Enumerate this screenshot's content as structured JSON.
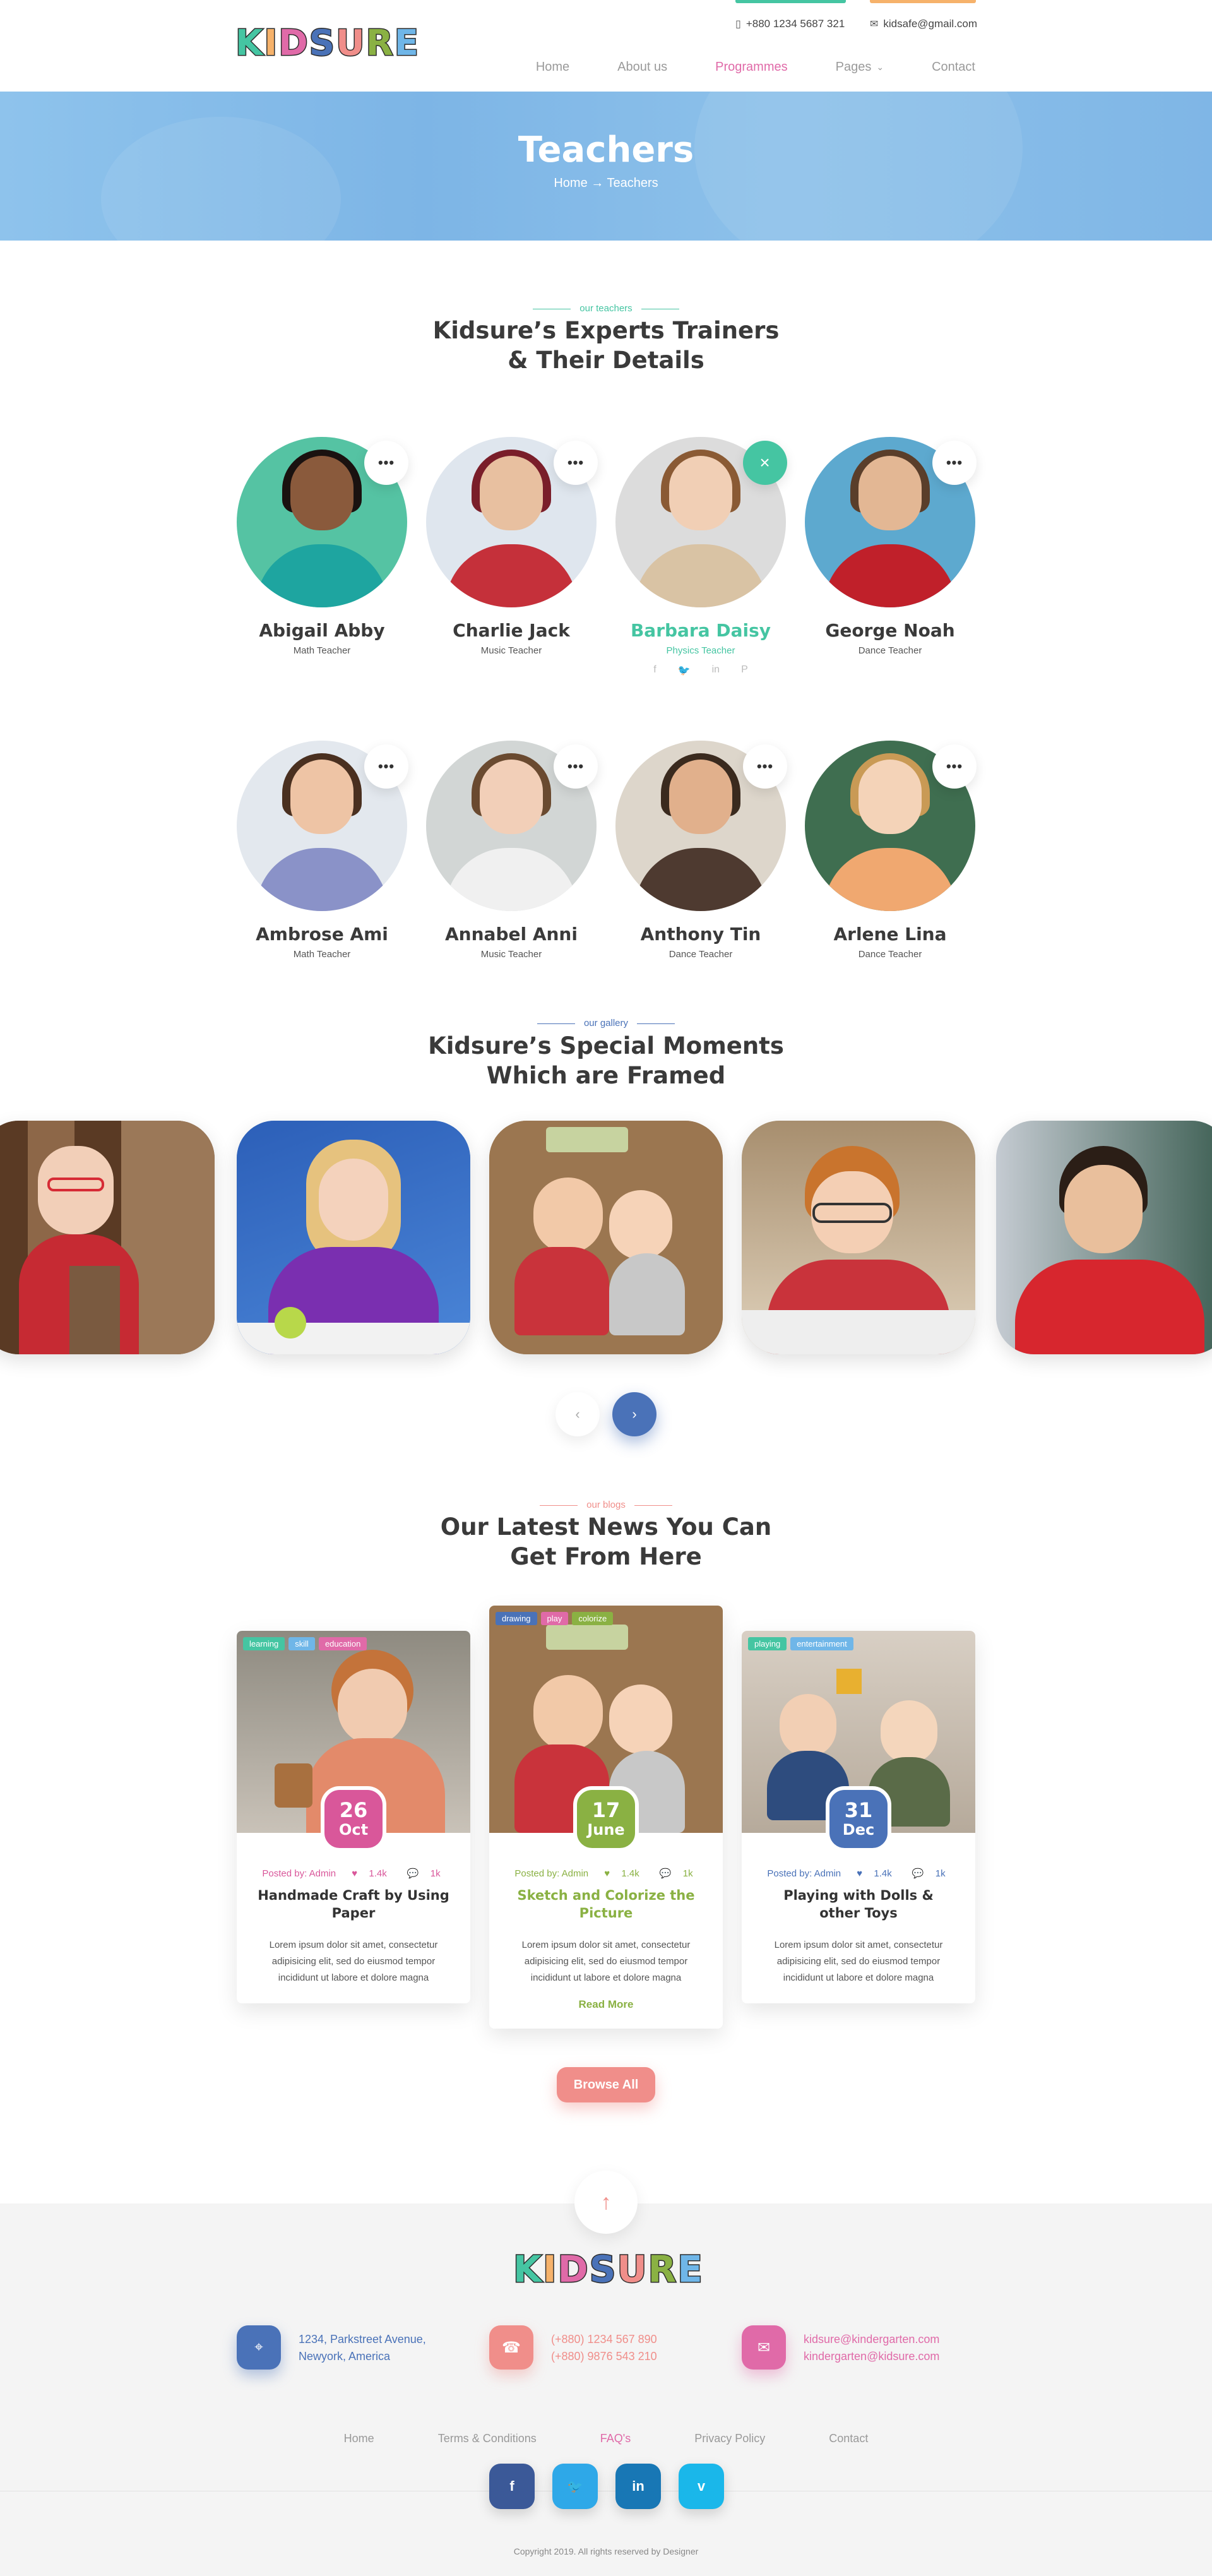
{
  "header": {
    "logo": "KIDSURE",
    "phone": "+880 1234 5687 321",
    "email": "kidsafe@gmail.com",
    "accent_left": "#45c5a2",
    "accent_right": "#f6b26b",
    "nav": [
      {
        "label": "Home",
        "active": false
      },
      {
        "label": "About us",
        "active": false
      },
      {
        "label": "Programmes",
        "active": true
      },
      {
        "label": "Pages",
        "active": false,
        "dropdown": true
      },
      {
        "label": "Contact",
        "active": false
      }
    ]
  },
  "banner": {
    "title": "Teachers",
    "breadcrumb_home": "Home",
    "breadcrumb_sep": "→",
    "breadcrumb_current": "Teachers"
  },
  "teachers_section": {
    "eyebrow": "our teachers",
    "title_line1": "Kidsure’s Experts Trainers",
    "title_line2": "& Their Details",
    "teachers": [
      {
        "name": "Abigail Abby",
        "role": "Math Teacher",
        "bg": "#55c3a3"
      },
      {
        "name": "Charlie Jack",
        "role": "Music Teacher",
        "bg": "#dfe6ee"
      },
      {
        "name": "Barbara Daisy",
        "role": "Physics Teacher",
        "bg": "#dcdcdc",
        "active": true
      },
      {
        "name": "George Noah",
        "role": "Dance Teacher",
        "bg": "#5da9cf"
      },
      {
        "name": "Ambrose Ami",
        "role": "Math Teacher",
        "bg": "#e3e8ee"
      },
      {
        "name": "Annabel Anni",
        "role": "Music Teacher",
        "bg": "#d2d6d5"
      },
      {
        "name": "Anthony Tin",
        "role": "Dance Teacher",
        "bg": "#ddd6cb"
      },
      {
        "name": "Arlene Lina",
        "role": "Dance Teacher",
        "bg": "#3f6e50"
      }
    ],
    "social_icons": [
      "facebook-icon",
      "twitter-icon",
      "linkedin-icon",
      "pinterest-icon"
    ],
    "active_social": "twitter-icon"
  },
  "gallery_section": {
    "eyebrow": "our gallery",
    "title_line1": "Kidsure’s Special Moments",
    "title_line2": "Which are Framed",
    "prev_icon": "‹",
    "next_icon": "›"
  },
  "blog_section": {
    "eyebrow": "our blogs",
    "title_line1": "Our Latest News You Can",
    "title_line2": "Get From Here",
    "posts": [
      {
        "tags": [
          "learning",
          "skill",
          "education"
        ],
        "day": "26",
        "month": "Oct",
        "posted_by": "Posted by: Admin",
        "likes": "1.4k",
        "comments": "1k",
        "title_line1": "Handmade Craft by Using",
        "title_line2": "Paper",
        "text_line1": "Lorem ipsum dolor sit amet, consectetur",
        "text_line2": "adipisicing elit, sed do eiusmod tempor",
        "text_line3": "incididunt ut labore et dolore magna",
        "color": "#d9579a"
      },
      {
        "tags": [
          "drawing",
          "play",
          "colorize"
        ],
        "day": "17",
        "month": "June",
        "posted_by": "Posted by: Admin",
        "likes": "1.4k",
        "comments": "1k",
        "title_line1": "Sketch and Colorize the",
        "title_line2": "Picture",
        "text_line1": "Lorem ipsum dolor sit amet, consectetur",
        "text_line2": "adipisicing elit, sed do eiusmod tempor",
        "text_line3": "incididunt ut labore et dolore magna",
        "read_more": "Read More",
        "color": "#8ab143"
      },
      {
        "tags": [
          "playing",
          "entertainment"
        ],
        "day": "31",
        "month": "Dec",
        "posted_by": "Posted by: Admin",
        "likes": "1.4k",
        "comments": "1k",
        "title_line1": "Playing with Dolls &",
        "title_line2": "other Toys",
        "text_line1": "Lorem ipsum dolor sit amet, consectetur",
        "text_line2": "adipisicing elit, sed do eiusmod tempor",
        "text_line3": "incididunt ut labore et dolore magna",
        "color": "#4a72b8"
      }
    ],
    "browse_label": "Browse All"
  },
  "footer": {
    "logo": "KIDSURE",
    "address_line1": "1234, Parkstreet Avenue,",
    "address_line2": "Newyork, America",
    "phone_line1": "(+880) 1234 567 890",
    "phone_line2": "(+880) 9876 543 210",
    "email_line1": "kidsure@kindergarten.com",
    "email_line2": "kindergarten@kidsure.com",
    "nav": [
      {
        "label": "Home",
        "active": false
      },
      {
        "label": "Terms & Conditions",
        "active": false
      },
      {
        "label": "FAQ's",
        "active": true
      },
      {
        "label": "Privacy Policy",
        "active": false
      },
      {
        "label": "Contact",
        "active": false
      }
    ],
    "socials": [
      {
        "label": "f",
        "color": "#3b5998"
      },
      {
        "label": "🐦",
        "color": "#2ea8e8"
      },
      {
        "label": "in",
        "color": "#1877b5"
      },
      {
        "label": "v",
        "color": "#1ab7ea"
      }
    ],
    "copyright": "Copyright 2019. All rights reserved by Designer"
  }
}
